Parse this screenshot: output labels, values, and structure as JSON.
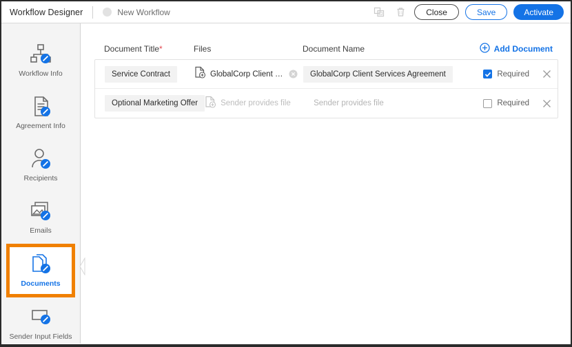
{
  "header": {
    "app_title": "Workflow Designer",
    "workflow_name": "New Workflow",
    "duplicate_icon": "copy-icon",
    "delete_icon": "trash-icon",
    "buttons": {
      "close": "Close",
      "save": "Save",
      "activate": "Activate"
    }
  },
  "sidebar": {
    "items": [
      {
        "label": "Workflow Info",
        "icon": "workflow-info-icon",
        "active": false
      },
      {
        "label": "Agreement Info",
        "icon": "agreement-info-icon",
        "active": false
      },
      {
        "label": "Recipients",
        "icon": "recipients-icon",
        "active": false
      },
      {
        "label": "Emails",
        "icon": "emails-icon",
        "active": false
      },
      {
        "label": "Documents",
        "icon": "documents-icon",
        "active": true
      },
      {
        "label": "Sender Input Fields",
        "icon": "sender-input-fields-icon",
        "active": false
      }
    ],
    "collapse_icon": "chevron-left-icon"
  },
  "main": {
    "columns": {
      "document_title": "Document Title",
      "required_marker": "*",
      "files": "Files",
      "document_name": "Document Name"
    },
    "add_document": {
      "label": "Add Document",
      "icon": "plus-circle-icon"
    },
    "required_label": "Required",
    "rows": [
      {
        "title": "Service Contract",
        "title_is_placeholder": false,
        "file_name": "GlobalCorp Client Servic...",
        "file_is_placeholder": false,
        "has_clear": true,
        "document_name": "GlobalCorp Client Services Agreement",
        "document_name_is_placeholder": false,
        "required": true
      },
      {
        "title": "Optional Marketing Offer",
        "title_is_placeholder": false,
        "file_name": "Sender provides file",
        "file_is_placeholder": true,
        "has_clear": false,
        "document_name": "Sender provides file",
        "document_name_is_placeholder": true,
        "required": false
      }
    ]
  },
  "colors": {
    "accent_blue": "#1473e6",
    "highlight_orange": "#f08000",
    "required_red": "#e34850",
    "sidebar_bg": "#f4f4f4",
    "field_bg": "#f2f2f2"
  }
}
